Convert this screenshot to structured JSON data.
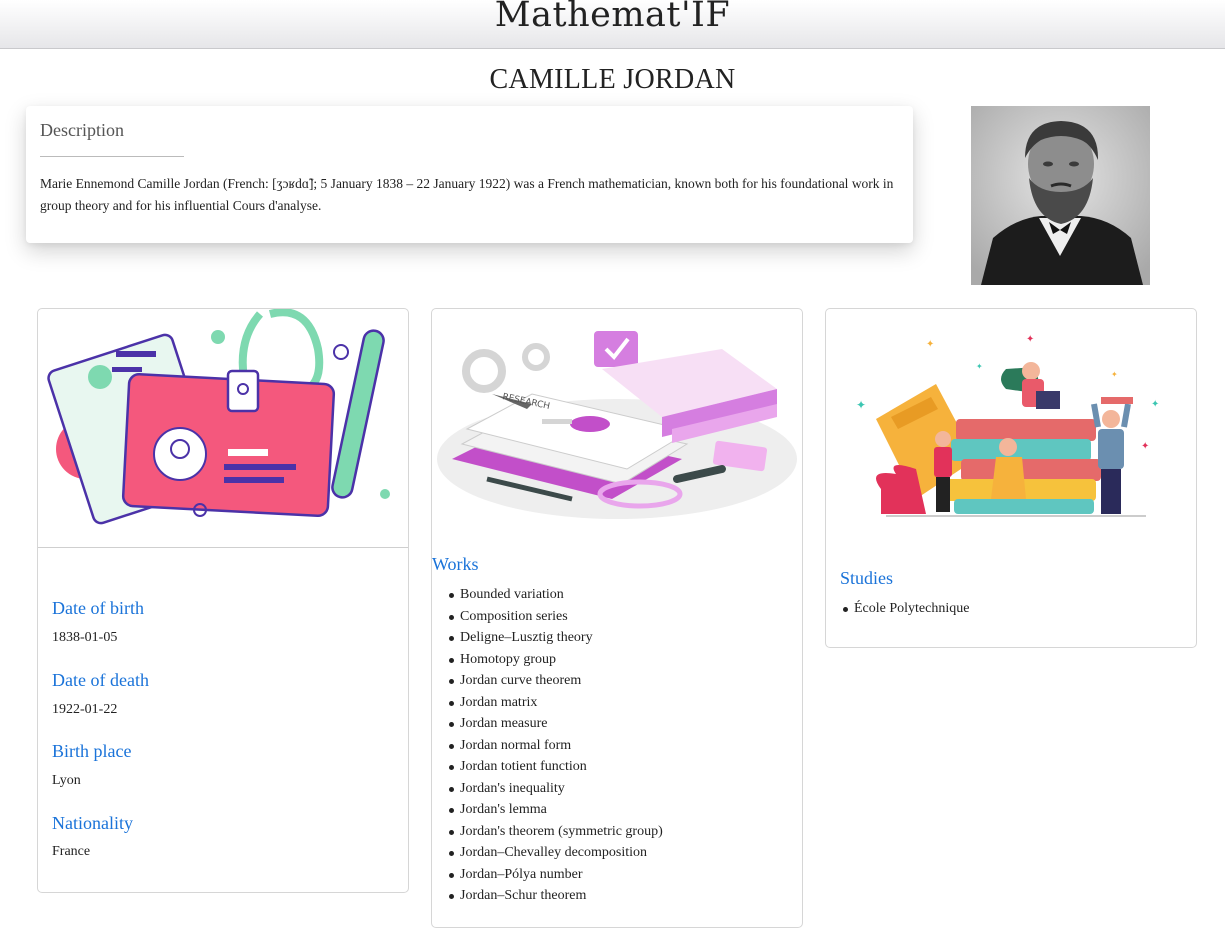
{
  "header": {
    "brand": "Mathemat'IF"
  },
  "page": {
    "title": "CAMILLE JORDAN"
  },
  "description": {
    "heading": "Description",
    "text": "Marie Ennemond Camille Jordan (French: [ʒɔʁdɑ̃]; 5 January 1838 – 22 January 1922) was a French mathematician, known both for his foundational work in group theory and for his influential Cours d'analyse."
  },
  "info": {
    "birth_label": "Date of birth",
    "birth_value": "1838-01-05",
    "death_label": "Date of death",
    "death_value": "1922-01-22",
    "place_label": "Birth place",
    "place_value": "Lyon",
    "nationality_label": "Nationality",
    "nationality_value": "France"
  },
  "works": {
    "title": "Works",
    "items": [
      "Bounded variation",
      "Composition series",
      "Deligne–Lusztig theory",
      "Homotopy group",
      "Jordan curve theorem",
      "Jordan matrix",
      "Jordan measure",
      "Jordan normal form",
      "Jordan totient function",
      "Jordan's inequality",
      "Jordan's lemma",
      "Jordan's theorem (symmetric group)",
      "Jordan–Chevalley decomposition",
      "Jordan–Pólya number",
      "Jordan–Schur theorem"
    ]
  },
  "studies": {
    "title": "Studies",
    "items": [
      "École Polytechnique"
    ]
  },
  "illustration_labels": {
    "research": "RESEARCH"
  },
  "colors": {
    "link_blue": "#1a73d9",
    "pink": "#f4587d",
    "mint": "#7ed9b0",
    "purple": "#4b32a8"
  }
}
